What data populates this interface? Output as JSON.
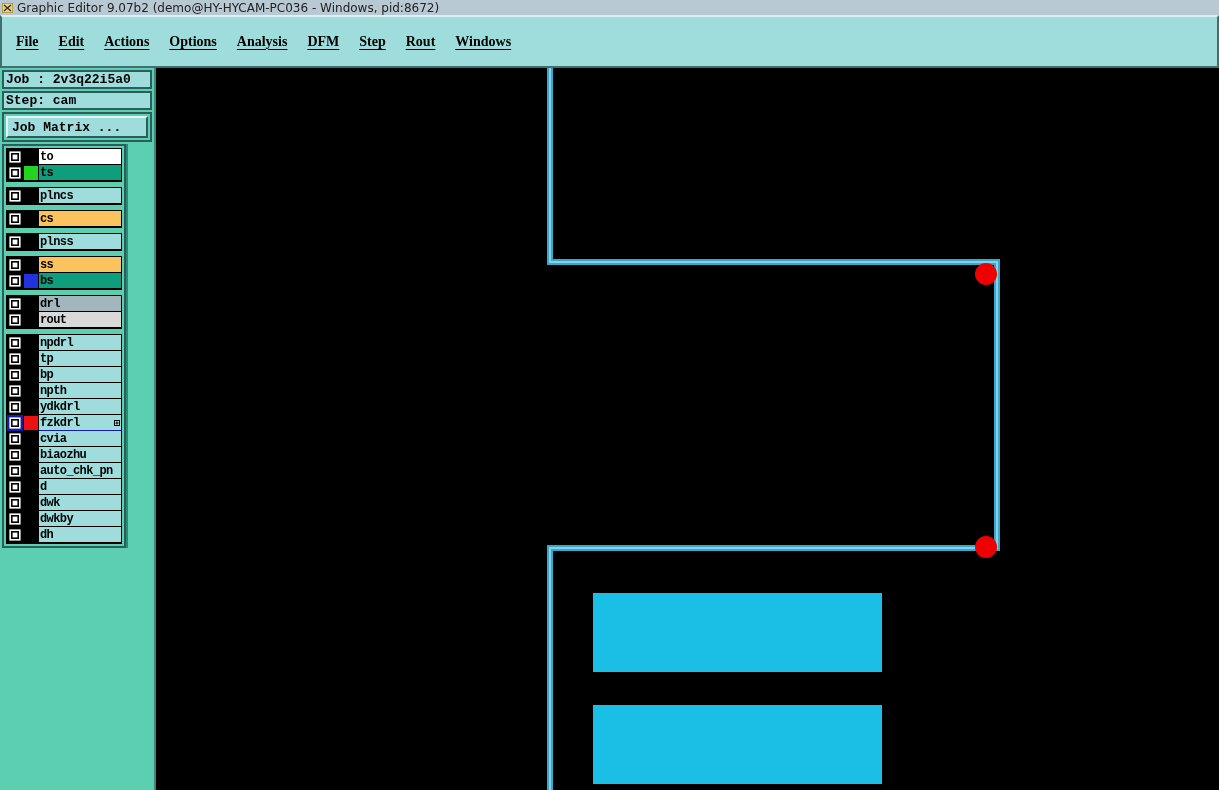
{
  "window": {
    "title": "Graphic Editor 9.07b2 (demo@HY-HYCAM-PC036 - Windows, pid:8672)"
  },
  "menu": [
    "File",
    "Edit",
    "Actions",
    "Options",
    "Analysis",
    "DFM",
    "Step",
    "Rout",
    "Windows"
  ],
  "job": {
    "job_label": "Job : 2v3q22i5a0",
    "step_label": "Step: cam",
    "matrix_button": "Job Matrix ..."
  },
  "layer_groups": [
    {
      "layers": [
        {
          "name": "to",
          "color": "#ffffff",
          "selected": false,
          "expandable": false
        },
        {
          "name": "ts",
          "color": "#0f9e7c",
          "swatch": {
            "color": "#22d322"
          },
          "selected": false,
          "expandable": false
        }
      ]
    },
    {
      "layers": [
        {
          "name": "plncs",
          "color": "#9fdcdc",
          "selected": false,
          "expandable": false
        }
      ]
    },
    {
      "layers": [
        {
          "name": "cs",
          "color": "#fbc35e",
          "selected": false,
          "expandable": false
        }
      ]
    },
    {
      "layers": [
        {
          "name": "plnss",
          "color": "#9fdcdc",
          "selected": false,
          "expandable": false
        }
      ]
    },
    {
      "layers": [
        {
          "name": "ss",
          "color": "#fbc35e",
          "selected": false,
          "expandable": false
        },
        {
          "name": "bs",
          "color": "#0f9e7c",
          "swatch": {
            "color": "#2233dd"
          },
          "selected": false,
          "expandable": false
        }
      ]
    },
    {
      "layers": [
        {
          "name": "drl",
          "color": "#a3b6bd",
          "selected": false,
          "expandable": false
        },
        {
          "name": "rout",
          "color": "#d9d9d9",
          "selected": false,
          "expandable": false
        }
      ]
    },
    {
      "layers": [
        {
          "name": "npdrl",
          "color": "#9fdcdc",
          "selected": false,
          "expandable": false
        },
        {
          "name": "tp",
          "color": "#9fdcdc",
          "selected": false,
          "expandable": false
        },
        {
          "name": "bp",
          "color": "#9fdcdc",
          "selected": false,
          "expandable": false
        },
        {
          "name": "npth",
          "color": "#9fdcdc",
          "selected": false,
          "expandable": false
        },
        {
          "name": "ydkdrl",
          "color": "#9fdcdc",
          "selected": false,
          "expandable": false
        },
        {
          "name": "fzkdrl",
          "color": "#9fdcdc",
          "swatch": {
            "color": "#ee1111"
          },
          "selected": true,
          "expandable": true
        },
        {
          "name": "cvia",
          "color": "#9fdcdc",
          "selected": false,
          "expandable": false
        },
        {
          "name": "biaozhu",
          "color": "#9fdcdc",
          "selected": false,
          "expandable": false
        },
        {
          "name": "auto_chk_pn",
          "color": "#9fdcdc",
          "selected": false,
          "expandable": false
        },
        {
          "name": "d",
          "color": "#9fdcdc",
          "selected": false,
          "expandable": false
        },
        {
          "name": "dwk",
          "color": "#9fdcdc",
          "selected": false,
          "expandable": false
        },
        {
          "name": "dwkby",
          "color": "#9fdcdc",
          "selected": false,
          "expandable": false
        },
        {
          "name": "dh",
          "color": "#9fdcdc",
          "selected": false,
          "expandable": false
        }
      ]
    }
  ]
}
